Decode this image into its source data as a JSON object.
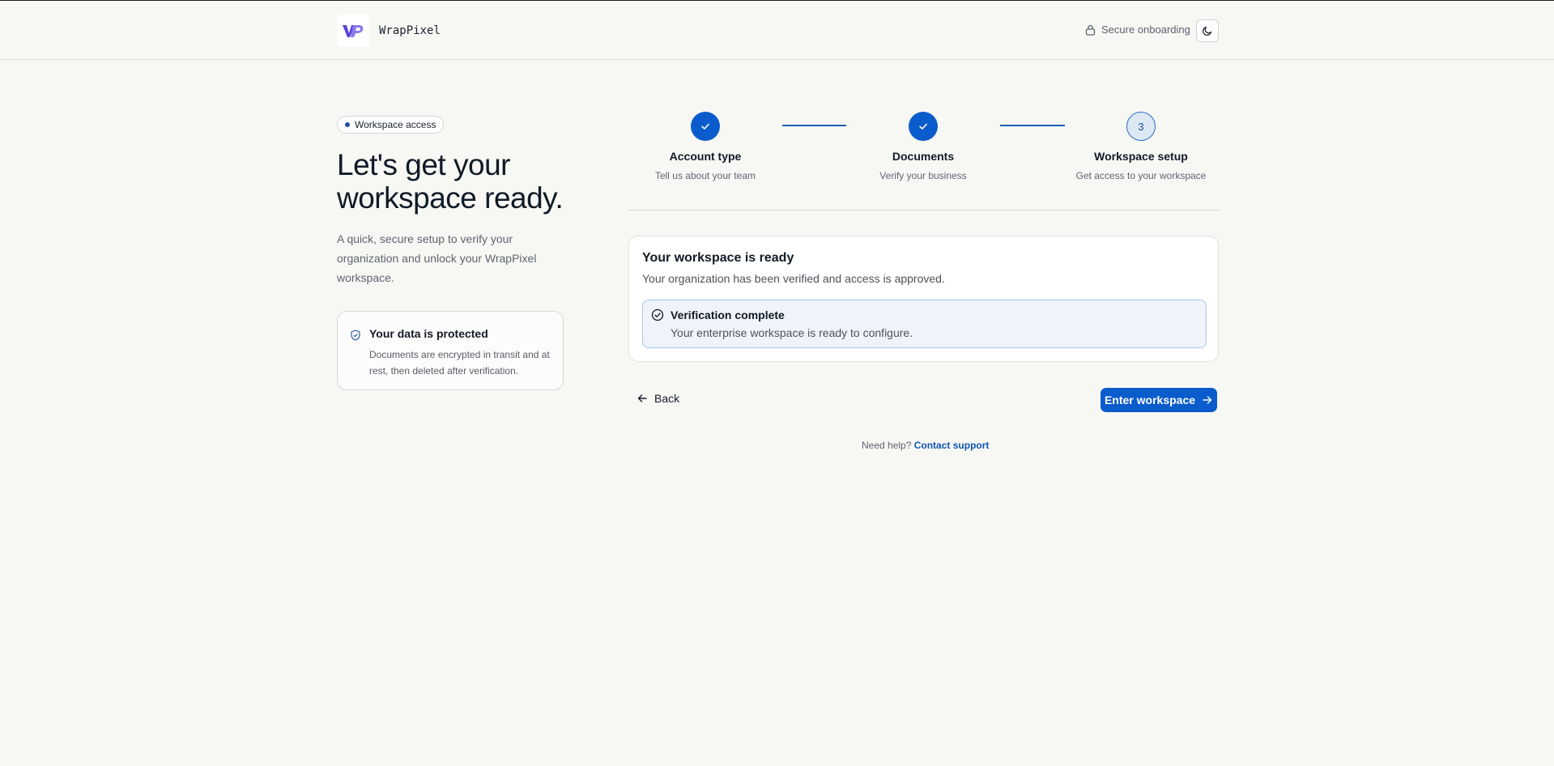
{
  "header": {
    "brand_name": "WrapPixel",
    "secure_label": "Secure onboarding",
    "icons": {
      "lock": "lock-icon",
      "theme": "moon-icon"
    }
  },
  "intro": {
    "badge": "Workspace access",
    "title": "Let's get your workspace ready.",
    "description": "A quick, secure setup to verify your organization and unlock your WrapPixel workspace.",
    "protect_title": "Your data is protected",
    "protect_text": "Documents are encrypted in transit and at rest, then deleted after verification."
  },
  "steps": [
    {
      "label": "Account type",
      "sub": "Tell us about your team",
      "state": "done"
    },
    {
      "label": "Documents",
      "sub": "Verify your business",
      "state": "done"
    },
    {
      "number": "3",
      "label": "Workspace setup",
      "sub": "Get access to your workspace",
      "state": "active"
    }
  ],
  "card": {
    "title": "Your workspace is ready",
    "subtitle": "Your organization has been verified and access is approved.",
    "verify_title": "Verification complete",
    "verify_text": "Your enterprise workspace is ready to configure."
  },
  "actions": {
    "back_label": "Back",
    "enter_label": "Enter workspace"
  },
  "help": {
    "text": "Need help?",
    "link": "Contact support"
  },
  "colors": {
    "accent": "#0a5ccc",
    "background": "#f7f7f4",
    "verify_bg": "#eff4fa"
  }
}
